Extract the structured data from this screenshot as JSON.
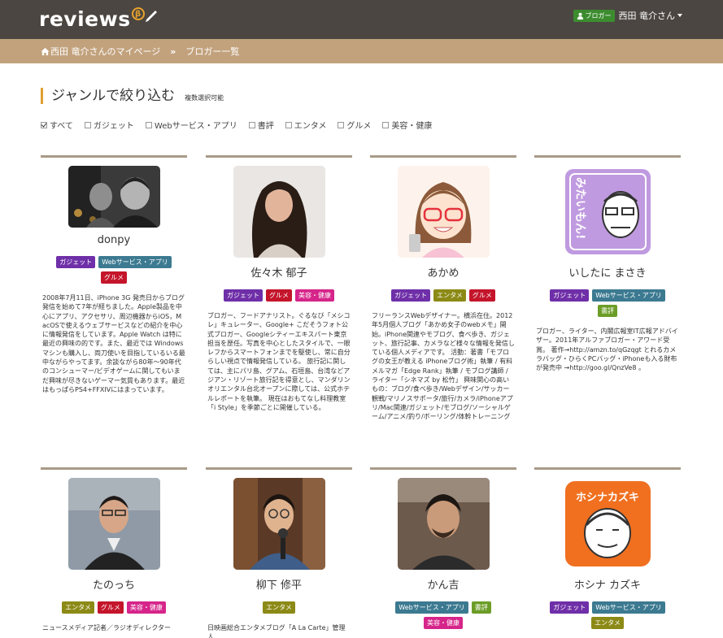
{
  "header": {
    "logo_text": "reviews",
    "logo_beta": "β",
    "role_badge": "ブロガー",
    "user_name": "西田 竜介さん"
  },
  "breadcrumb": {
    "mypage": "西田 竜介さんのマイページ",
    "separator": "»",
    "current": "ブロガー一覧"
  },
  "section": {
    "title": "ジャンルで絞り込む",
    "note": "複数選択可能"
  },
  "filters": [
    {
      "label": "すべて",
      "checked": true
    },
    {
      "label": "ガジェット",
      "checked": false
    },
    {
      "label": "Webサービス・アプリ",
      "checked": false
    },
    {
      "label": "書評",
      "checked": false
    },
    {
      "label": "エンタメ",
      "checked": false
    },
    {
      "label": "グルメ",
      "checked": false
    },
    {
      "label": "美容・健康",
      "checked": false
    }
  ],
  "bloggers": [
    {
      "name": "donpy",
      "tags": [
        "ガジェット",
        "Webサービス・アプリ",
        "グルメ"
      ],
      "desc": "2008年7月11日、iPhone 3G 発売日からブログ発信を始めて7年が経ちました。Apple製品を中心にアプリ、アクセサリ、周辺機器からiOS，MacOSで使えるウェブサービスなどの紹介を中心に情報発信をしています。Apple Watch は特に最近の興味の的です。また、最近では Windows マシンも購入し、両刀使いを目指しているいる最中ながらやってます。余談ながら80年〜90年代のコンシューマー/ビデオゲームに関してもいまだ興味が尽きないゲーマー気質もあります。最近はもっぱらPS4+FFXIVにはまっています。"
    },
    {
      "name": "佐々木 郁子",
      "tags": [
        "ガジェット",
        "グルメ",
        "美容・健康"
      ],
      "desc": "ブロガー、フードアナリスト。ぐるなび「メシコレ」キュレーター、Google+ こだそうフォト公式ブロガー、Googleシティーエキスパート東京担当を歴任。写真を中心としたスタイルで、一眼レフからスマートフォンまでを駆使し、常に自分らしい視点で情報発信している。 旅行記に関しては、主にパリ島、グアム、石垣島、台湾などアジアン・リゾート旅行記を得意とし、マンダリンオリエンタル台北オープンに際しては、公式ホテルレポートを執筆。 現在はおもてなし料理教室「i Style」を季節ごとに開催している。"
    },
    {
      "name": "あかめ",
      "tags": [
        "ガジェット",
        "エンタメ",
        "グルメ"
      ],
      "desc": "フリーランスWebデザイナー。横浜在住。2012年5月個人ブログ「あかめ女子のwebメモ」開始。iPhone関連やモブログ、食べ歩き、ガジェット、旅行記事、カメラなど様々な情報を発信している個人メディアです。 活動：著書「モブログの女王が教える iPhoneブログ術」執筆 / 有料メルマガ「Edge Rank」執筆 / モブログ講師 / ライター「シネマズ by 松竹」 興味関心の高いもの：ブログ/食べ歩き/Webデザイン/サッカー観戦/マリノスサポータ/旅行/カメラ/iPhoneアプリ/Mac関連/ガジェット/モブログ/ソーシャルゲーム/アニメ/釣り/ボーリング/体幹トレーニング"
    },
    {
      "name": "いしたに まさき",
      "tags": [
        "ガジェット",
        "Webサービス・アプリ",
        "書評"
      ],
      "desc": "ブロガー、ライター、内閣広報室IT広報アドバイザー。2011年アルファブロガー・アワード受賞。 著作→http://amzn.to/qGzqgt とれるカメラバッグ・ひらくPCバッグ・iPhoneも入る財布が発売中 →http://goo.gl/QnzVe8 。"
    },
    {
      "name": "たのっち",
      "tags": [
        "エンタメ",
        "グルメ",
        "美容・健康"
      ],
      "desc": "ニュースメディア記者／ラジオディレクター"
    },
    {
      "name": "柳下 修平",
      "tags": [
        "エンタメ"
      ],
      "desc": "日映画総合エンタメブログ「A La Carte」管理人"
    },
    {
      "name": "かん吉",
      "tags": [
        "Webサービス・アプリ",
        "書評",
        "美容・健康"
      ],
      "desc": ""
    },
    {
      "name": "ホシナ カズキ",
      "tags": [
        "ガジェット",
        "Webサービス・アプリ",
        "エンタメ"
      ],
      "desc": ""
    }
  ],
  "icons": {
    "avatar_text_mitai": "みたいもん!",
    "avatar_text_hoshina": "ホシナカズキ"
  }
}
